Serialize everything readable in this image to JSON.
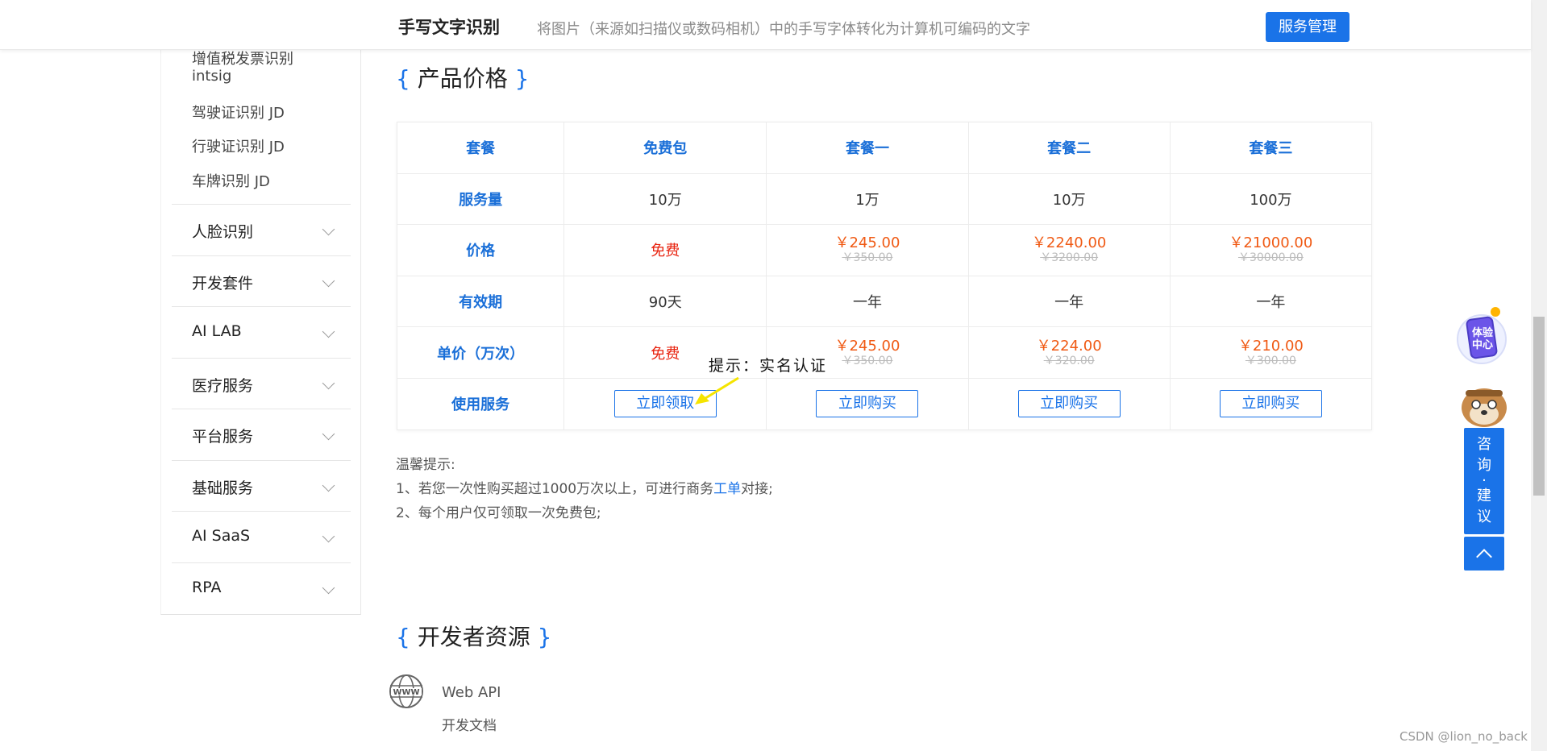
{
  "header": {
    "title": "手写文字识别",
    "description": "将图片（来源如扫描仪或数码相机）中的手写字体转化为计算机可编码的文字",
    "manage_button": "服务管理"
  },
  "sidebar": {
    "sub_items": [
      {
        "label": "增值税发票识别"
      },
      {
        "label": "intsig"
      },
      {
        "label": "驾驶证识别 JD"
      },
      {
        "label": "行驶证识别 JD"
      },
      {
        "label": "车牌识别 JD"
      }
    ],
    "groups": [
      {
        "label": "人脸识别"
      },
      {
        "label": "开发套件"
      },
      {
        "label": "AI LAB"
      },
      {
        "label": "医疗服务"
      },
      {
        "label": "平台服务"
      },
      {
        "label": "基础服务"
      },
      {
        "label": "AI SaaS"
      },
      {
        "label": "RPA"
      }
    ]
  },
  "pricing": {
    "section_title": "产品价格",
    "header_row": [
      "套餐",
      "免费包",
      "套餐一",
      "套餐二",
      "套餐三"
    ],
    "row_labels": [
      "服务量",
      "价格",
      "有效期",
      "单价（万次）",
      "使用服务"
    ],
    "volume": [
      "10万",
      "1万",
      "10万",
      "100万"
    ],
    "price": {
      "free": "免费",
      "plans": [
        {
          "now": "￥245.00",
          "old": "￥350.00"
        },
        {
          "now": "￥2240.00",
          "old": "￥3200.00"
        },
        {
          "now": "￥21000.00",
          "old": "￥30000.00"
        }
      ]
    },
    "validity": [
      "90天",
      "一年",
      "一年",
      "一年"
    ],
    "unit_price": {
      "free": "免费",
      "plans": [
        {
          "now": "￥245.00",
          "old": "￥350.00"
        },
        {
          "now": "￥224.00",
          "old": "￥320.00"
        },
        {
          "now": "￥210.00",
          "old": "￥300.00"
        }
      ]
    },
    "buttons": [
      "立即领取",
      "立即购买",
      "立即购买",
      "立即购买"
    ]
  },
  "annotation": {
    "text": "提示：实名认证",
    "arrow_color": "#f5e400"
  },
  "notes": {
    "title": "温馨提示:",
    "line1_prefix": "1、若您一次性购买超过1000万次以上，可进行商务",
    "line1_link": "工单",
    "line1_suffix": "对接;",
    "line2": "2、每个用户仅可领取一次免费包;"
  },
  "developer": {
    "section_title": "开发者资源",
    "resource_name": "Web API",
    "resource_link": "开发文档",
    "icon": "globe-icon"
  },
  "floating": {
    "experience_label_1": "体验",
    "experience_label_2": "中心",
    "consult_chars": [
      "咨",
      "询",
      "·",
      "建",
      "议"
    ]
  },
  "watermark": "CSDN @lion_no_back",
  "colors": {
    "accent": "#1a73e8",
    "price": "#f05a14",
    "free": "#e8220e"
  }
}
